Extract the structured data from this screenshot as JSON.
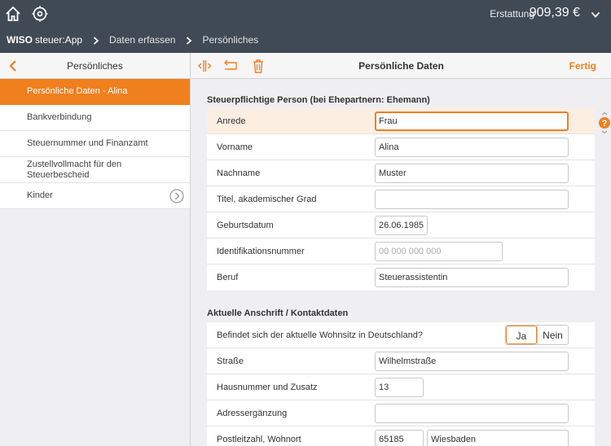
{
  "header": {
    "refund_label": "Erstattung",
    "refund_amount": "909,39 €",
    "breadcrumb": {
      "app_bold": "WISO",
      "app_rest": "steuer:App",
      "step2": "Daten erfassen",
      "step3": "Persönliches"
    }
  },
  "sidebar": {
    "title": "Persönliches",
    "items": [
      {
        "label": "Persönliche Daten - Alina"
      },
      {
        "label": "Bankverbindung"
      },
      {
        "label": "Steuernummer und Finanzamt"
      },
      {
        "label": "Zustellvollmacht für den Steuerbescheid"
      },
      {
        "label": "Kinder"
      }
    ]
  },
  "main": {
    "title": "Persönliche Daten",
    "done_label": "Fertig",
    "section1": {
      "title": "Steuerpflichtige Person (bei Ehepartnern: Ehemann)",
      "rows": [
        {
          "label": "Anrede",
          "value": "Frau"
        },
        {
          "label": "Vorname",
          "value": "Alina"
        },
        {
          "label": "Nachname",
          "value": "Muster"
        },
        {
          "label": "Titel, akademischer Grad",
          "value": ""
        },
        {
          "label": "Geburtsdatum",
          "value": "26.06.1985"
        },
        {
          "label": "Identifikationsnummer",
          "placeholder": "00 000 000 000"
        },
        {
          "label": "Beruf",
          "value": "Steuerassistentin"
        }
      ]
    },
    "section2": {
      "title": "Aktuelle Anschrift / Kontaktdaten",
      "residence_question": "Befindet sich der aktuelle Wohnsitz in Deutschland?",
      "yes_label": "Ja",
      "no_label": "Nein",
      "rows": [
        {
          "label": "Straße",
          "value": "Wilhelmstraße"
        },
        {
          "label": "Hausnummer und Zusatz",
          "value": "13"
        },
        {
          "label": "Adressergänzung",
          "value": ""
        },
        {
          "label": "Postleitzahl, Wohnort",
          "postcode": "65185",
          "city": "Wiesbaden"
        }
      ]
    }
  },
  "colors": {
    "accent": "#f07f1d",
    "header_bg": "#3f4a55",
    "highlight_row": "#fdeee2"
  },
  "icons": [
    "home-icon",
    "gear-icon",
    "chevron-down-icon",
    "back-chevron-icon",
    "resize-icon",
    "undo-icon",
    "trash-icon",
    "circle-chevron-right-icon",
    "help-icon"
  ]
}
